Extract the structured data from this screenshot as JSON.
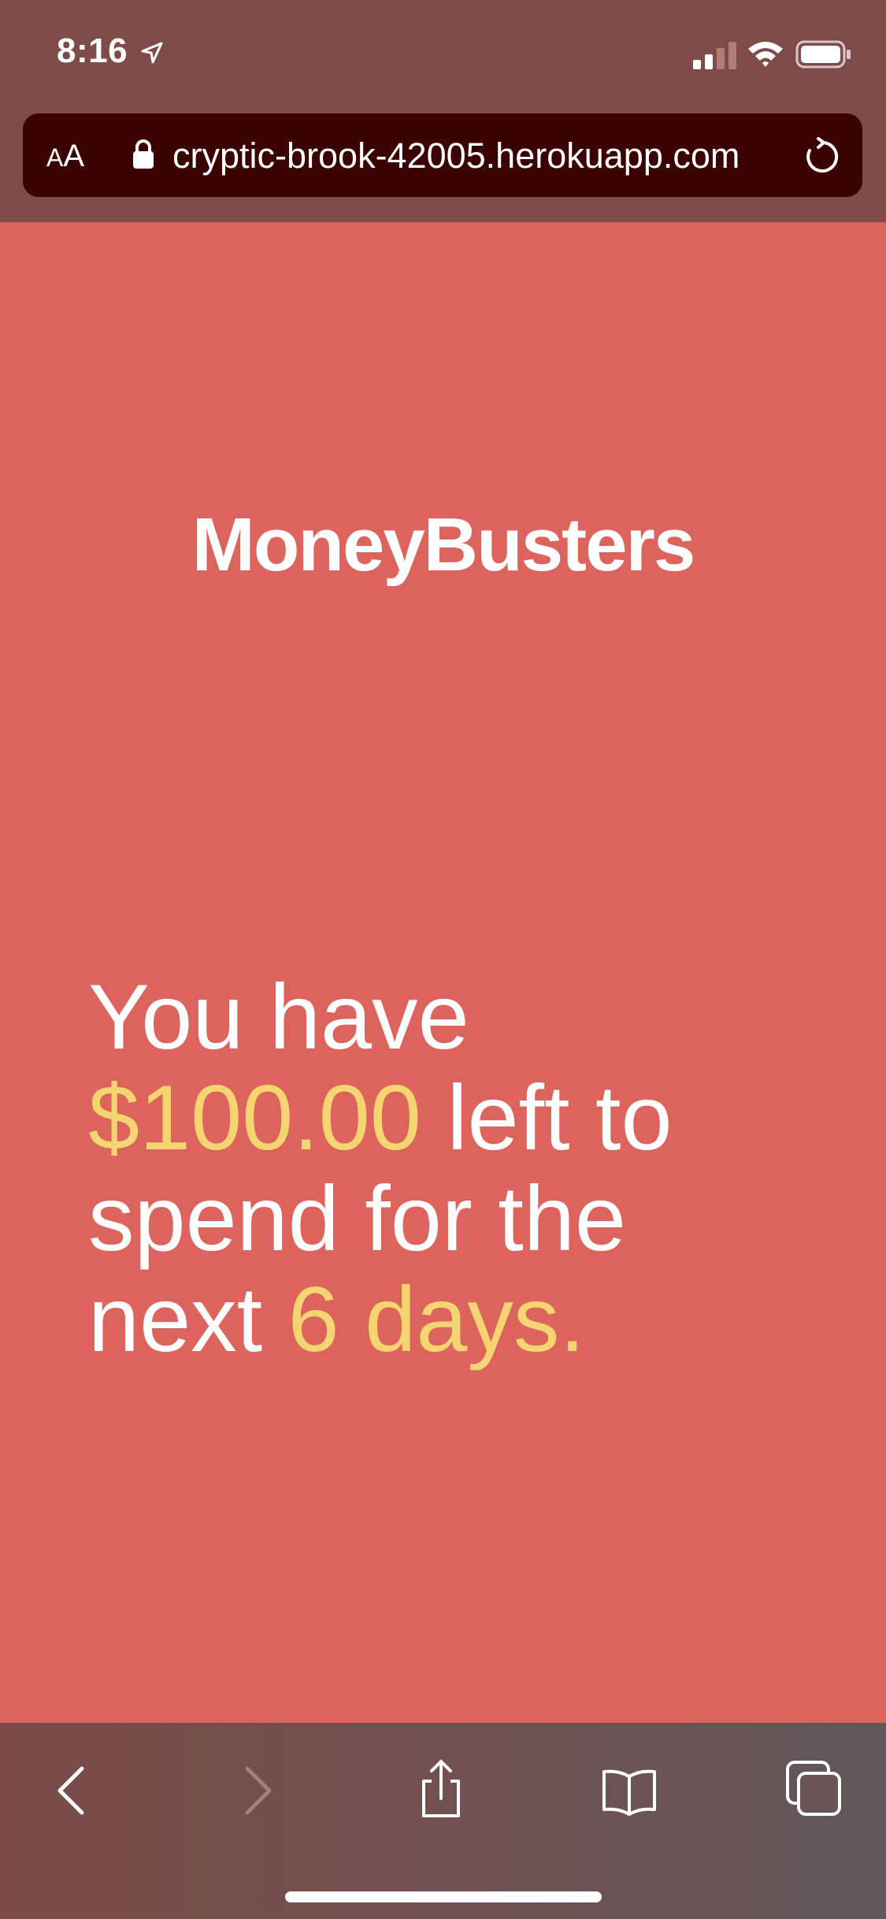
{
  "status_bar": {
    "time": "8:16",
    "icons": [
      "location-arrow-icon",
      "cellular-signal-icon",
      "wifi-icon",
      "battery-icon"
    ]
  },
  "browser": {
    "text_size_label_small": "A",
    "text_size_label_large": "A",
    "url": "cryptic-brook-42005.herokuapp.com",
    "icons": [
      "lock-icon",
      "reload-icon"
    ]
  },
  "app": {
    "brand": "MoneyBusters",
    "message": {
      "prefix": "You have",
      "amount": "$100.00",
      "middle": "left to spend for the next",
      "days": "6 days."
    }
  },
  "toolbar": {
    "icons": [
      "back-icon",
      "forward-icon",
      "share-icon",
      "bookmarks-icon",
      "tabs-icon"
    ]
  },
  "colors": {
    "background": "#dd645c",
    "chrome": "#7e4b49",
    "url_bar": "#3b0202",
    "highlight": "#f4d572",
    "text": "#ffffff"
  }
}
